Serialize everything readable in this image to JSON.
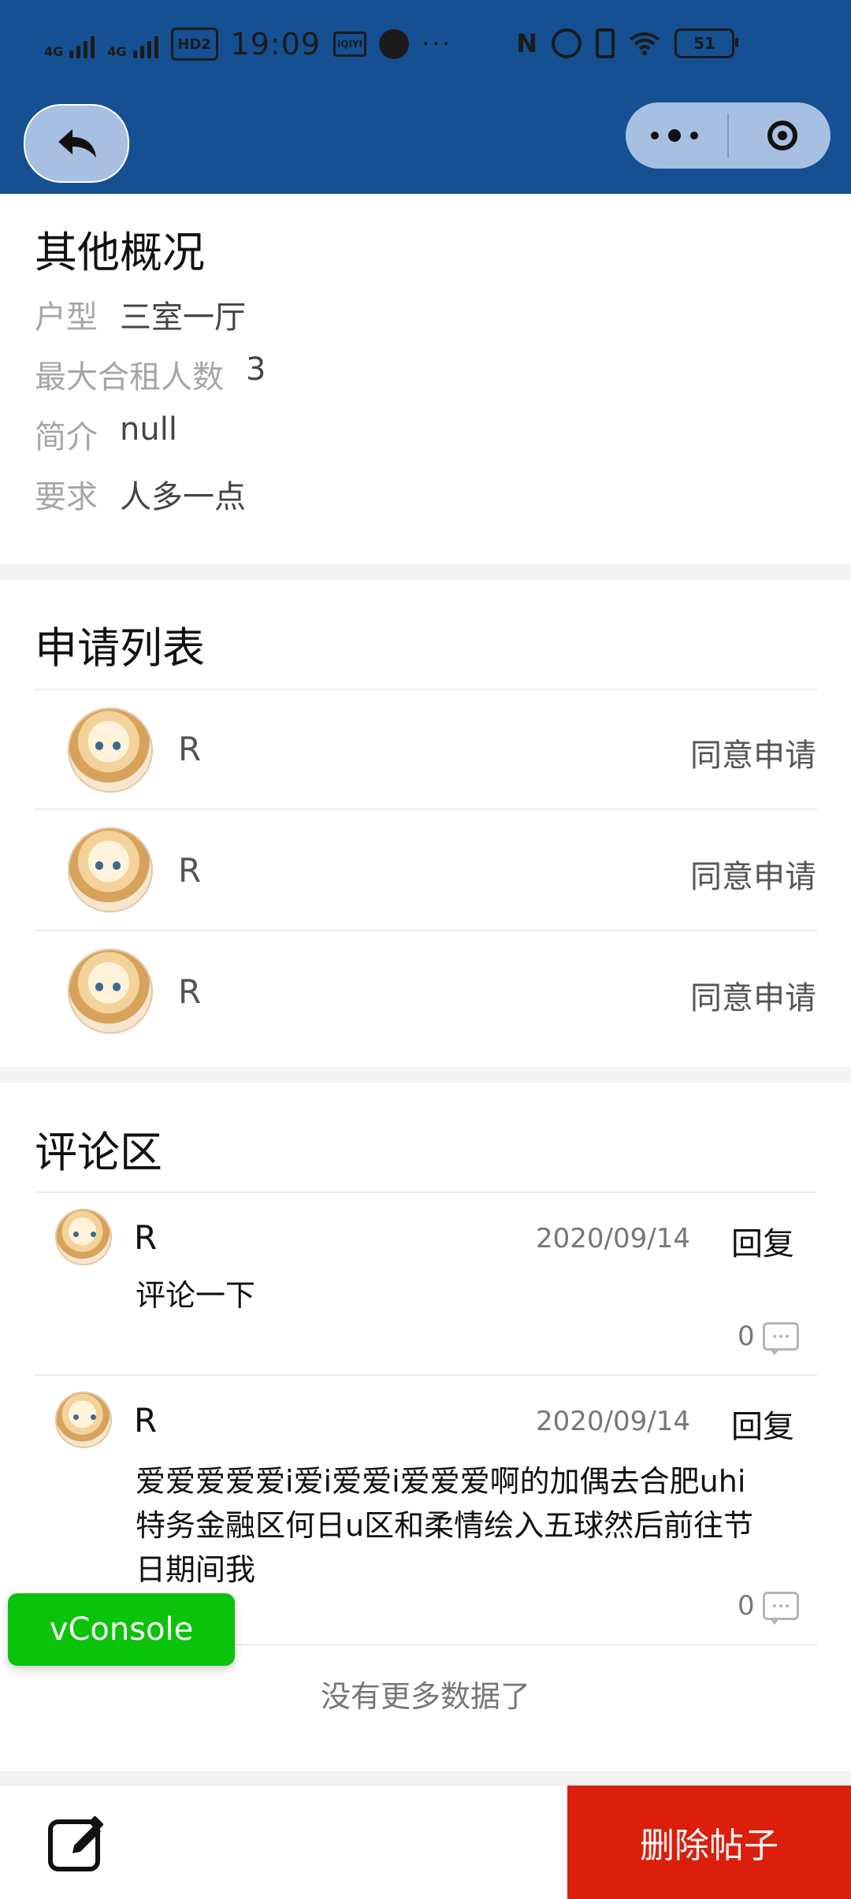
{
  "status_bar": {
    "network_1": "4G",
    "network_2": "4G",
    "hd_label": "HD2",
    "time": "19:09",
    "iqiyi_label": "iQIYI",
    "more": "···",
    "nfc": "N",
    "battery": "51"
  },
  "header": {
    "back_icon": "back-arrow-icon",
    "capsule_more_icon": "more-dots-icon",
    "capsule_close_icon": "target-ring-icon"
  },
  "overview": {
    "title": "其他概况",
    "rows": [
      {
        "key": "户型",
        "value": "三室一厅"
      },
      {
        "key": "最大合租人数",
        "value": "3"
      },
      {
        "key": "简介",
        "value": "null"
      },
      {
        "key": "要求",
        "value": "人多一点"
      }
    ]
  },
  "applications": {
    "title": "申请列表",
    "items": [
      {
        "name": "R",
        "action": "同意申请"
      },
      {
        "name": "R",
        "action": "同意申请"
      },
      {
        "name": "R",
        "action": "同意申请"
      }
    ]
  },
  "comments": {
    "title": "评论区",
    "items": [
      {
        "name": "R",
        "date": "2020/09/14",
        "reply_label": "回复",
        "text": "评论一下",
        "count": "0"
      },
      {
        "name": "R",
        "date": "2020/09/14",
        "reply_label": "回复",
        "text": "爱爱爱爱爱i爱i爱爱i爱爱爱啊的加偶去合肥uhi特务金融区何日u区和柔情绘入五球然后前往节日期间我",
        "count": "0"
      }
    ],
    "no_more": "没有更多数据了"
  },
  "vconsole": {
    "label": "vConsole"
  },
  "bottom": {
    "edit_icon": "edit-icon",
    "delete_label": "删除帖子"
  },
  "colors": {
    "header_bg": "#145092",
    "capsule_bg": "#a7bfe1",
    "delete_bg": "#dc1e0c",
    "vconsole_bg": "#0bc30b"
  }
}
